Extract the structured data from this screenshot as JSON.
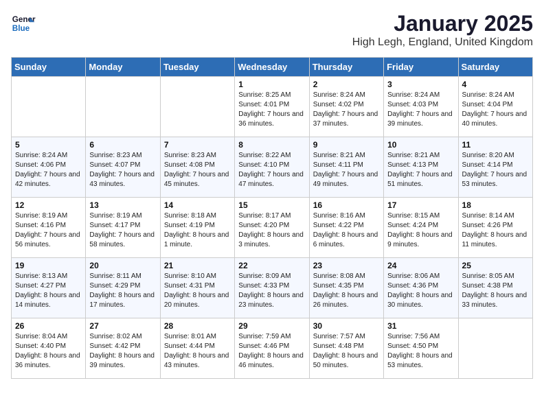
{
  "logo": {
    "line1": "General",
    "line2": "Blue"
  },
  "title": "January 2025",
  "location": "High Legh, England, United Kingdom",
  "weekdays": [
    "Sunday",
    "Monday",
    "Tuesday",
    "Wednesday",
    "Thursday",
    "Friday",
    "Saturday"
  ],
  "weeks": [
    [
      {
        "day": "",
        "info": ""
      },
      {
        "day": "",
        "info": ""
      },
      {
        "day": "",
        "info": ""
      },
      {
        "day": "1",
        "info": "Sunrise: 8:25 AM\nSunset: 4:01 PM\nDaylight: 7 hours and 36 minutes."
      },
      {
        "day": "2",
        "info": "Sunrise: 8:24 AM\nSunset: 4:02 PM\nDaylight: 7 hours and 37 minutes."
      },
      {
        "day": "3",
        "info": "Sunrise: 8:24 AM\nSunset: 4:03 PM\nDaylight: 7 hours and 39 minutes."
      },
      {
        "day": "4",
        "info": "Sunrise: 8:24 AM\nSunset: 4:04 PM\nDaylight: 7 hours and 40 minutes."
      }
    ],
    [
      {
        "day": "5",
        "info": "Sunrise: 8:24 AM\nSunset: 4:06 PM\nDaylight: 7 hours and 42 minutes."
      },
      {
        "day": "6",
        "info": "Sunrise: 8:23 AM\nSunset: 4:07 PM\nDaylight: 7 hours and 43 minutes."
      },
      {
        "day": "7",
        "info": "Sunrise: 8:23 AM\nSunset: 4:08 PM\nDaylight: 7 hours and 45 minutes."
      },
      {
        "day": "8",
        "info": "Sunrise: 8:22 AM\nSunset: 4:10 PM\nDaylight: 7 hours and 47 minutes."
      },
      {
        "day": "9",
        "info": "Sunrise: 8:21 AM\nSunset: 4:11 PM\nDaylight: 7 hours and 49 minutes."
      },
      {
        "day": "10",
        "info": "Sunrise: 8:21 AM\nSunset: 4:13 PM\nDaylight: 7 hours and 51 minutes."
      },
      {
        "day": "11",
        "info": "Sunrise: 8:20 AM\nSunset: 4:14 PM\nDaylight: 7 hours and 53 minutes."
      }
    ],
    [
      {
        "day": "12",
        "info": "Sunrise: 8:19 AM\nSunset: 4:16 PM\nDaylight: 7 hours and 56 minutes."
      },
      {
        "day": "13",
        "info": "Sunrise: 8:19 AM\nSunset: 4:17 PM\nDaylight: 7 hours and 58 minutes."
      },
      {
        "day": "14",
        "info": "Sunrise: 8:18 AM\nSunset: 4:19 PM\nDaylight: 8 hours and 1 minute."
      },
      {
        "day": "15",
        "info": "Sunrise: 8:17 AM\nSunset: 4:20 PM\nDaylight: 8 hours and 3 minutes."
      },
      {
        "day": "16",
        "info": "Sunrise: 8:16 AM\nSunset: 4:22 PM\nDaylight: 8 hours and 6 minutes."
      },
      {
        "day": "17",
        "info": "Sunrise: 8:15 AM\nSunset: 4:24 PM\nDaylight: 8 hours and 9 minutes."
      },
      {
        "day": "18",
        "info": "Sunrise: 8:14 AM\nSunset: 4:26 PM\nDaylight: 8 hours and 11 minutes."
      }
    ],
    [
      {
        "day": "19",
        "info": "Sunrise: 8:13 AM\nSunset: 4:27 PM\nDaylight: 8 hours and 14 minutes."
      },
      {
        "day": "20",
        "info": "Sunrise: 8:11 AM\nSunset: 4:29 PM\nDaylight: 8 hours and 17 minutes."
      },
      {
        "day": "21",
        "info": "Sunrise: 8:10 AM\nSunset: 4:31 PM\nDaylight: 8 hours and 20 minutes."
      },
      {
        "day": "22",
        "info": "Sunrise: 8:09 AM\nSunset: 4:33 PM\nDaylight: 8 hours and 23 minutes."
      },
      {
        "day": "23",
        "info": "Sunrise: 8:08 AM\nSunset: 4:35 PM\nDaylight: 8 hours and 26 minutes."
      },
      {
        "day": "24",
        "info": "Sunrise: 8:06 AM\nSunset: 4:36 PM\nDaylight: 8 hours and 30 minutes."
      },
      {
        "day": "25",
        "info": "Sunrise: 8:05 AM\nSunset: 4:38 PM\nDaylight: 8 hours and 33 minutes."
      }
    ],
    [
      {
        "day": "26",
        "info": "Sunrise: 8:04 AM\nSunset: 4:40 PM\nDaylight: 8 hours and 36 minutes."
      },
      {
        "day": "27",
        "info": "Sunrise: 8:02 AM\nSunset: 4:42 PM\nDaylight: 8 hours and 39 minutes."
      },
      {
        "day": "28",
        "info": "Sunrise: 8:01 AM\nSunset: 4:44 PM\nDaylight: 8 hours and 43 minutes."
      },
      {
        "day": "29",
        "info": "Sunrise: 7:59 AM\nSunset: 4:46 PM\nDaylight: 8 hours and 46 minutes."
      },
      {
        "day": "30",
        "info": "Sunrise: 7:57 AM\nSunset: 4:48 PM\nDaylight: 8 hours and 50 minutes."
      },
      {
        "day": "31",
        "info": "Sunrise: 7:56 AM\nSunset: 4:50 PM\nDaylight: 8 hours and 53 minutes."
      },
      {
        "day": "",
        "info": ""
      }
    ]
  ]
}
